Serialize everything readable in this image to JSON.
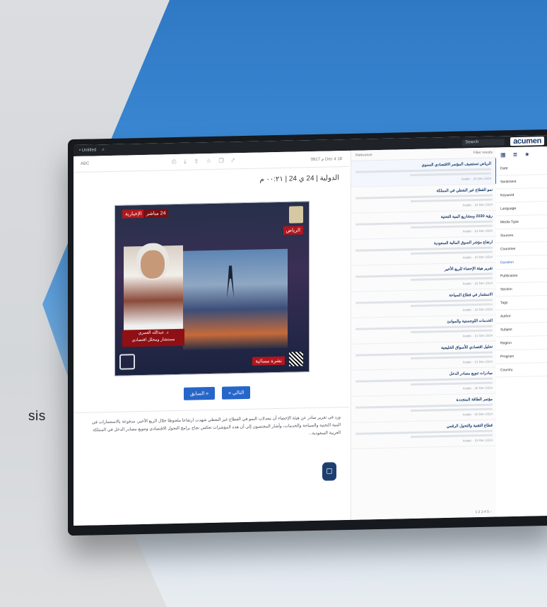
{
  "background": {
    "partial_word": "sis",
    "accent": "#2f78c4"
  },
  "browser": {
    "tab_label": "• Untitled",
    "search_label": "Search",
    "search_icon": "search-icon",
    "brand": "acumen"
  },
  "article": {
    "toolbar_left": "ABC",
    "toolbar_right": "م 0917 Dec 4 18",
    "title": "الدولية | 24 ي 24 | ٠٠:٢١ م"
  },
  "video": {
    "channel_tag": "الإخبارية",
    "live_tag": "24 مباشر",
    "city_tag": "الرياض",
    "name_caption": "د. عبدالله العمري",
    "name_sub": "مستشار ومحلل اقتصادي",
    "ticker": "نشرة مسائية"
  },
  "nav": {
    "prev_label": "« السابق",
    "next_label": "التالي »"
  },
  "body": {
    "paragraph": "ورد في تقرير صادر عن هيئة الإحصاء أن معدلات النمو في القطاع غير النفطي شهدت ارتفاعا ملحوظا خلال الربع الأخير، مدفوعة بالاستثمارات في البنية التحتية والسياحة والخدمات، وأشار المختصون إلى أن هذه المؤشرات تعكس نجاح برامج التحول الاقتصادي وتنويع مصادر الدخل في المملكة العربية السعودية..."
  },
  "results": {
    "header_left": "Relevance",
    "header_right": "Filter results",
    "items": [
      {
        "title": "الرياض تستضيف المؤتمر الاقتصادي السنوي",
        "meta": "Arabic · 24 Dec 2024"
      },
      {
        "title": "نمو القطاع غير النفطي في المملكة",
        "meta": "Arabic · 24 Dec 2024"
      },
      {
        "title": "رؤية 2030 ومشاريع البنية التحتية",
        "meta": "Arabic · 23 Dec 2024"
      },
      {
        "title": "ارتفاع مؤشر السوق المالية السعودية",
        "meta": "Arabic · 23 Dec 2024"
      },
      {
        "title": "تقرير هيئة الإحصاء للربع الأخير",
        "meta": "Arabic · 22 Dec 2024"
      },
      {
        "title": "الاستثمار في قطاع السياحة",
        "meta": "Arabic · 22 Dec 2024"
      },
      {
        "title": "الخدمات اللوجستية والموانئ",
        "meta": "Arabic · 21 Dec 2024"
      },
      {
        "title": "تحليل اقتصادي للأسواق الخليجية",
        "meta": "Arabic · 21 Dec 2024"
      },
      {
        "title": "مبادرات تنويع مصادر الدخل",
        "meta": "Arabic · 20 Dec 2024"
      },
      {
        "title": "مؤتمر الطاقة المتجددة",
        "meta": "Arabic · 20 Dec 2024"
      },
      {
        "title": "قطاع التقنية والتحول الرقمي",
        "meta": "Arabic · 19 Dec 2024"
      }
    ],
    "pager": "1 2 3 4 5 ›"
  },
  "filters": {
    "items": [
      "Date",
      "Sentiment",
      "Keyword",
      "Language",
      "Media Type",
      "Sources",
      "Countries",
      "Duration",
      "Publication",
      "Section",
      "Tags",
      "Author",
      "Subject",
      "Region",
      "Program",
      "Country"
    ]
  }
}
